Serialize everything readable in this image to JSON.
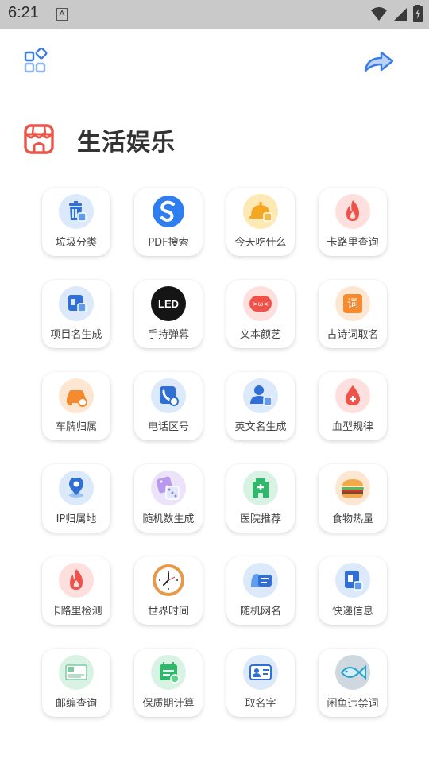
{
  "status_bar": {
    "time": "6:21",
    "notification_letter": "A"
  },
  "section": {
    "title": "生活娱乐"
  },
  "tools": [
    {
      "label": "垃圾分类",
      "icon": "trash-bin-icon"
    },
    {
      "label": "PDF搜索",
      "icon": "search-s-icon"
    },
    {
      "label": "今天吃什么",
      "icon": "food-cloche-icon"
    },
    {
      "label": "卡路里查询",
      "icon": "flame-icon"
    },
    {
      "label": "项目名生成",
      "icon": "project-name-icon"
    },
    {
      "label": "手持弹幕",
      "icon": "led-icon",
      "icon_text": "LED"
    },
    {
      "label": "文本颜艺",
      "icon": "emoticon-icon",
      "icon_text": ">ω<"
    },
    {
      "label": "古诗词取名",
      "icon": "poem-name-icon",
      "icon_text": "词"
    },
    {
      "label": "车牌归属",
      "icon": "car-search-icon"
    },
    {
      "label": "电话区号",
      "icon": "phone-search-icon"
    },
    {
      "label": "英文名生成",
      "icon": "user-en-icon"
    },
    {
      "label": "血型规律",
      "icon": "blood-drop-icon"
    },
    {
      "label": "IP归属地",
      "icon": "location-pin-icon"
    },
    {
      "label": "随机数生成",
      "icon": "dice-icon"
    },
    {
      "label": "医院推荐",
      "icon": "hospital-icon"
    },
    {
      "label": "食物热量",
      "icon": "burger-icon"
    },
    {
      "label": "卡路里检测",
      "icon": "flame-icon"
    },
    {
      "label": "世界时间",
      "icon": "clock-icon"
    },
    {
      "label": "随机网名",
      "icon": "chat-name-icon"
    },
    {
      "label": "快递信息",
      "icon": "express-info-icon"
    },
    {
      "label": "邮编查询",
      "icon": "postcode-icon"
    },
    {
      "label": "保质期计算",
      "icon": "calendar-check-icon"
    },
    {
      "label": "取名字",
      "icon": "id-card-icon"
    },
    {
      "label": "闲鱼违禁词",
      "icon": "fish-icon"
    }
  ],
  "colors": {
    "accent": "#3b7be6",
    "header_icon": "#e8564a"
  }
}
